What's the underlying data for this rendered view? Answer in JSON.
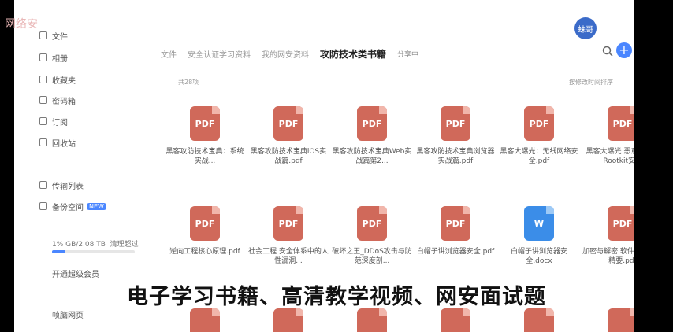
{
  "watermark": "网络安",
  "avatar_text": "蛛哥",
  "sidebar": {
    "items": [
      {
        "label": "文件",
        "icon": "file-icon"
      },
      {
        "label": "相册",
        "icon": "photo-icon"
      },
      {
        "label": "收藏夹",
        "icon": "star-icon"
      },
      {
        "label": "密码箱",
        "icon": "lock-icon"
      },
      {
        "label": "订阅",
        "icon": "subscribe-icon"
      },
      {
        "label": "回收站",
        "icon": "trash-icon"
      },
      {
        "label": "传输列表",
        "icon": "transfer-icon"
      },
      {
        "label": "备份空间",
        "icon": "backup-icon",
        "badge": "NEW"
      }
    ],
    "storage_text": "1% GB/2.08 TB",
    "storage_link": "清理超过",
    "storage_used_fraction": 0.15,
    "vip_label": "开通超级会员",
    "footer_label": "帧脑网页"
  },
  "tabs": [
    {
      "label": "文件",
      "active": false
    },
    {
      "label": "安全认证学习资料",
      "active": false
    },
    {
      "label": "我的网安资料",
      "active": false
    },
    {
      "label": "攻防技术类书籍",
      "active": true
    },
    {
      "label": "分享中",
      "active": false,
      "small": true
    }
  ],
  "file_count": "共28项",
  "sort_label": "按修改时间排序",
  "files": [
    {
      "name": "黑客攻防技术宝典：系统实战...",
      "type": "PDF"
    },
    {
      "name": "黑客攻防技术宝典iOS实战篇.pdf",
      "type": "PDF"
    },
    {
      "name": "黑客攻防技术宝典Web实战篇第2...",
      "type": "PDF"
    },
    {
      "name": "黑客攻防技术宝典浏览器实战篇.pdf",
      "type": "PDF"
    },
    {
      "name": "黑客大曝光：无线网络安全.pdf",
      "type": "PDF"
    },
    {
      "name": "黑客大曝光 恶意软件和Rootkit安...",
      "type": "PDF"
    },
    {
      "name": "逆向工程核心原理.pdf",
      "type": "PDF"
    },
    {
      "name": "社会工程 安全体系中的人性漏洞...",
      "type": "PDF"
    },
    {
      "name": "破坏之王_DDoS攻击与防范深度剖...",
      "type": "PDF"
    },
    {
      "name": "白帽子讲浏览器安全.pdf",
      "type": "PDF"
    },
    {
      "name": "白帽子讲浏览器安全.docx",
      "type": "W"
    },
    {
      "name": "加密与解密 软件漏洞分析精要.pdf",
      "type": "PDF"
    }
  ],
  "caption": "电子学习书籍、高清教学视频、网安面试题"
}
